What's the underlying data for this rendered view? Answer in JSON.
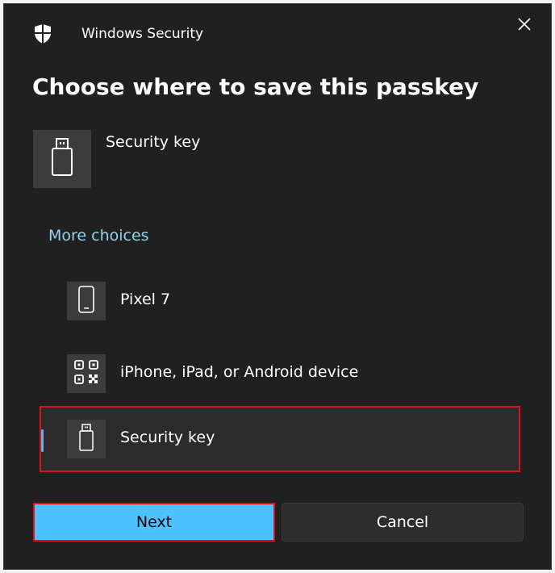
{
  "window": {
    "title": "Windows Security",
    "close_icon": "close-icon",
    "app_icon": "shield-icon"
  },
  "heading": "Choose where to save this passkey",
  "selected": {
    "label": "Security key",
    "icon": "usb-key-icon"
  },
  "more_choices": {
    "label": "More choices",
    "options": [
      {
        "label": "Pixel 7",
        "icon": "phone-icon",
        "selected": false
      },
      {
        "label": "iPhone, iPad, or Android device",
        "icon": "qr-code-icon",
        "selected": false
      },
      {
        "label": "Security key",
        "icon": "usb-key-icon",
        "selected": true
      }
    ]
  },
  "buttons": {
    "next": "Next",
    "cancel": "Cancel"
  },
  "colors": {
    "accent": "#4cc2ff",
    "link": "#8fd3f0",
    "highlight_border": "#e0111b",
    "background": "#202020"
  }
}
